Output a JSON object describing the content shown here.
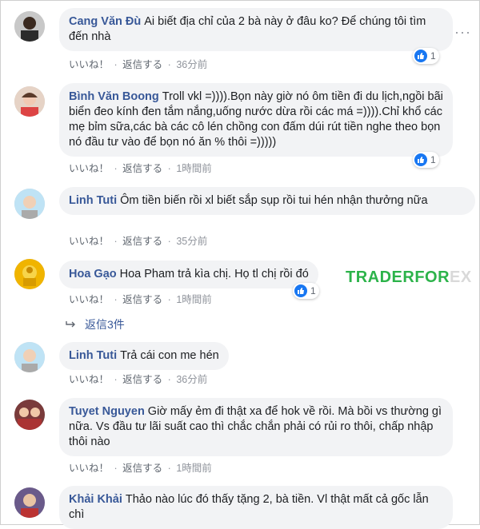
{
  "comments": [
    {
      "author": "Cang Văn Đù",
      "text": "Ai biết địa chỉ của 2 bà này ở đâu ko? Để chúng tôi tìm đến nhà",
      "like": "いいね！",
      "reply": "返信する",
      "time": "36分前",
      "reaction_count": "1"
    },
    {
      "author": "Bình Văn Boong",
      "text": "Troll vkl =)))).Bọn này giờ nó ôm tiền đi du lịch,ngồi bãi biển đeo kính đen tắm nắng,uống nước dừa rồi các má =)))).Chỉ khổ các mẹ bỉm sữa,các bà các cô lén chồng con đấm dúi rút tiền nghe theo bọn nó đầu tư vào để bọn nó ăn % thôi =)))))",
      "like": "いいね！",
      "reply": "返信する",
      "time": "1時間前",
      "reaction_count": "1"
    },
    {
      "author": "Linh Tuti",
      "text": "Ôm tiền biến rồi xl biết sắp sụp rồi tui hén nhận thưởng nữa",
      "like": "いいね！",
      "reply": "返信する",
      "time": "35分前"
    },
    {
      "author": "Hoa Gạo",
      "text": "Hoa Pham trả kìa chị. Họ tl chị rồi đó",
      "like": "いいね！",
      "reply": "返信する",
      "time": "1時間前",
      "reaction_count": "1"
    },
    {
      "author": "Linh Tuti",
      "text": "Trả cái con me hén",
      "like": "いいね！",
      "reply": "返信する",
      "time": "36分前"
    },
    {
      "author": "Tuyet Nguyen",
      "text": "Giờ mấy ẻm đi thật xa để hok về rồi. Mà bồi vs thường gì nữa. Vs đầu tư lãi suất cao thì chắc chắn phải có rủi ro thôi, chấp nhập thôi nào",
      "like": "いいね！",
      "reply": "返信する",
      "time": "1時間前"
    },
    {
      "author": "Khải Khải",
      "text": "Thảo nào lúc đó thấy tặng 2, bà tiền. Vl thật mất cả gốc lẫn chì"
    }
  ],
  "replies_link": "返信3件",
  "separator": "·",
  "more_icon": "more-dots-icon",
  "watermark": {
    "part1": "TRADERFOR",
    "part2": "EX"
  },
  "colors": {
    "author": "#385898",
    "like": "#1877f2",
    "bubble": "#f2f3f5",
    "watermark": "#2cb34a"
  }
}
